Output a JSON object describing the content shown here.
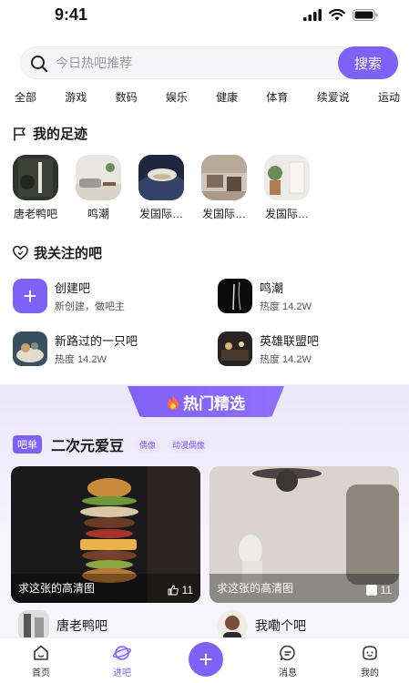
{
  "status_bar": {
    "time": "9:41"
  },
  "search": {
    "placeholder": "今日热吧推荐",
    "button_label": "搜索"
  },
  "categories": [
    "全部",
    "游戏",
    "数码",
    "娱乐",
    "健康",
    "体育",
    "续爱说",
    "运动"
  ],
  "footprints": {
    "title": "我的足迹",
    "items": [
      {
        "label": "唐老鸭吧"
      },
      {
        "label": "鸣潮"
      },
      {
        "label": "发国际…"
      },
      {
        "label": "发国际…"
      },
      {
        "label": "发国际…"
      }
    ]
  },
  "followed": {
    "title": "我关注的吧",
    "items": [
      {
        "name": "创建吧",
        "sub": "新创建，做吧主"
      },
      {
        "name": "鸣潮",
        "sub": "热度 14.2W"
      },
      {
        "name": "新路过的一只吧",
        "sub": "热度 14.2W"
      },
      {
        "name": "英雄联盟吧",
        "sub": "热度 14.2W"
      }
    ]
  },
  "hot": {
    "banner": "热门精选",
    "list_badge": "吧单",
    "list_title": "二次元爱豆",
    "tags": [
      "偶像",
      "动漫偶像"
    ],
    "posts": [
      {
        "caption": "求这张的高清图",
        "likes": "11",
        "author": "唐老鸭吧"
      },
      {
        "caption": "求这张的高清图",
        "likes": "11",
        "author": "我嘞个吧"
      }
    ]
  },
  "tab_bar": {
    "items": [
      {
        "label": "首页"
      },
      {
        "label": "进吧"
      },
      {
        "label": "消息"
      },
      {
        "label": "我的"
      }
    ]
  },
  "colors": {
    "accent": "#7e61f5"
  }
}
